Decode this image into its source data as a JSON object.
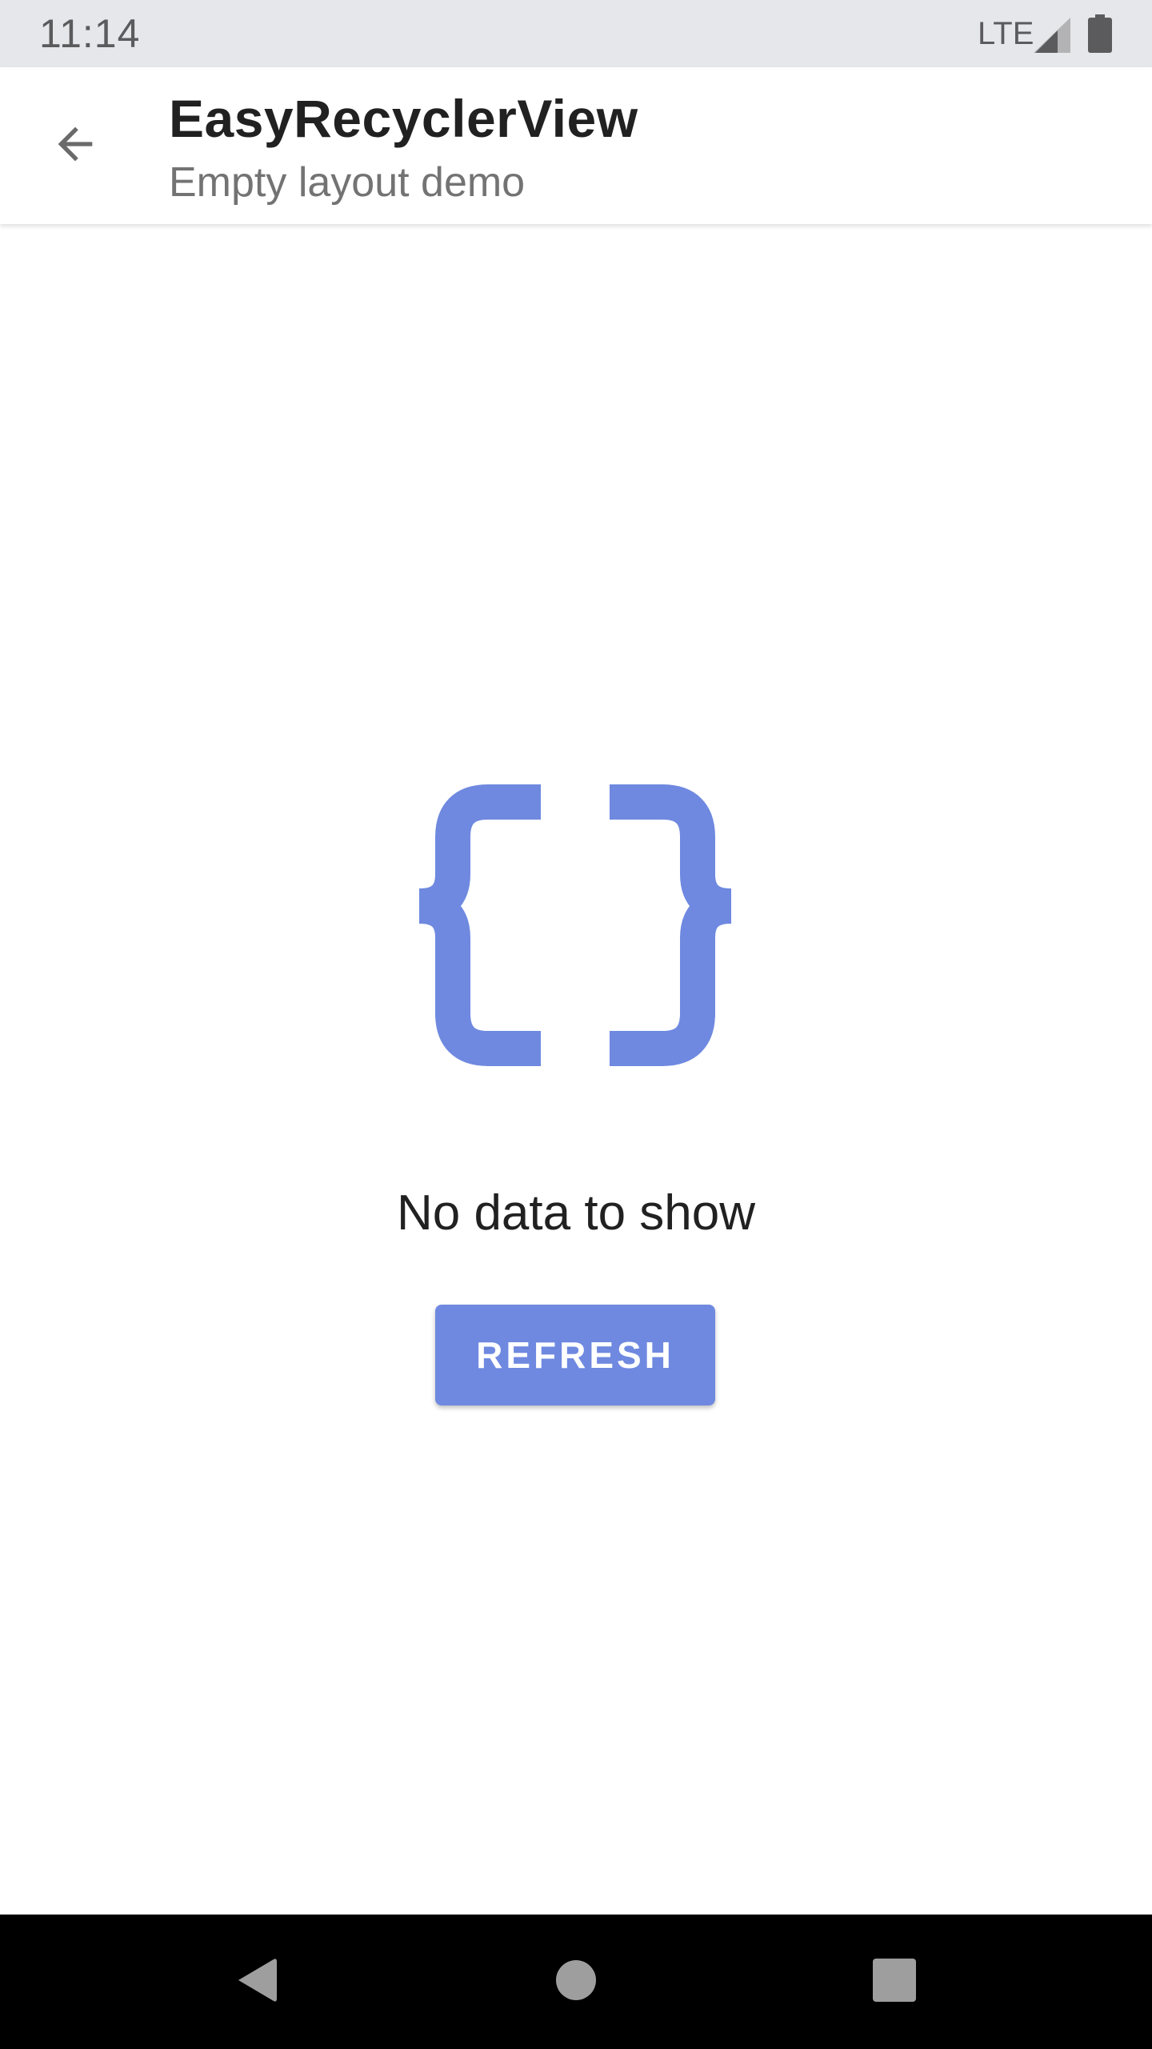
{
  "status_bar": {
    "time": "11:14",
    "network": "LTE",
    "icons": [
      "signal-icon",
      "battery-icon"
    ]
  },
  "app_bar": {
    "title": "EasyRecyclerView",
    "subtitle": "Empty layout demo",
    "back_icon": "arrow-back-icon"
  },
  "empty_state": {
    "icon": "curly-braces-icon",
    "message": "No data to show",
    "button_label": "REFRESH"
  },
  "nav_bar": {
    "icons": [
      "nav-back-icon",
      "nav-home-icon",
      "nav-recents-icon"
    ]
  },
  "colors": {
    "accent": "#6f89e0",
    "status_bar_bg": "#e6e7ea",
    "nav_bar_bg": "#000000",
    "title_text": "#212121",
    "subtitle_text": "#737373",
    "nav_icon": "#9e9e9e"
  }
}
